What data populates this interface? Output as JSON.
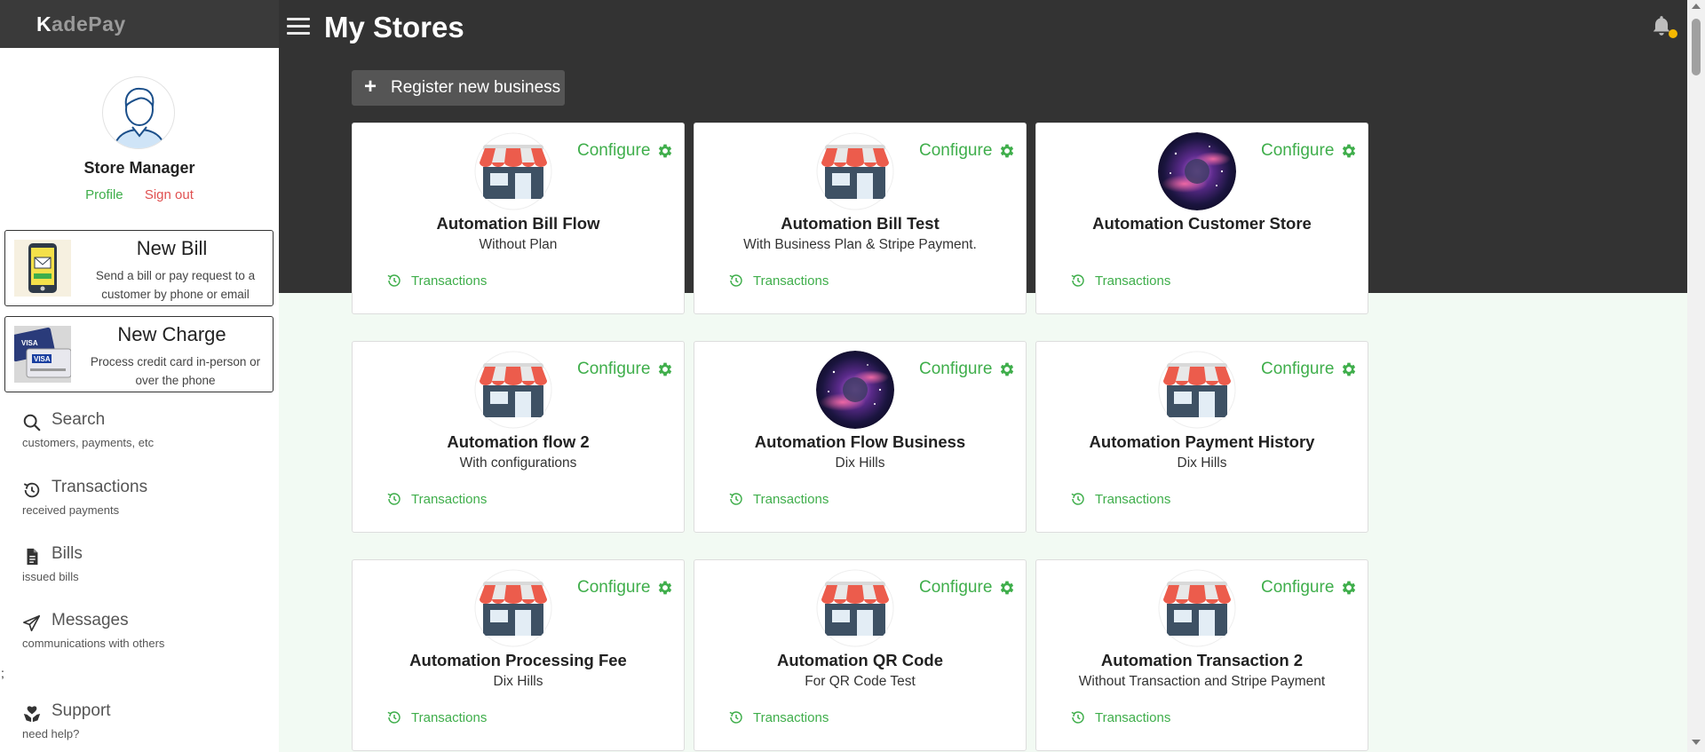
{
  "app": {
    "logo_first": "K",
    "logo_rest": "adePay"
  },
  "header": {
    "title": "My Stores"
  },
  "user": {
    "name": "Store Manager",
    "profile_label": "Profile",
    "signout_label": "Sign out"
  },
  "actions": [
    {
      "title": "New Bill",
      "desc": "Send a bill or pay request to a customer by phone or email"
    },
    {
      "title": "New Charge",
      "desc": "Process credit card in-person or over the phone"
    }
  ],
  "nav": [
    {
      "label": "Search",
      "sub": "customers, payments, etc",
      "icon": "search-icon"
    },
    {
      "label": "Transactions",
      "sub": "received payments",
      "icon": "history-icon"
    },
    {
      "label": "Bills",
      "sub": "issued bills",
      "icon": "document-icon"
    },
    {
      "label": "Messages",
      "sub": "communications with others",
      "icon": "send-icon"
    },
    {
      "label": "Support",
      "sub": "need help?",
      "icon": "support-icon"
    }
  ],
  "stray_text": ";",
  "register": {
    "label": "Register new business"
  },
  "stores": [
    {
      "name": "Automation Bill Flow",
      "sub": "Without Plan",
      "image": "storefront-icon",
      "configure": "Configure",
      "transactions": "Transactions"
    },
    {
      "name": "Automation Bill Test",
      "sub": "With Business Plan & Stripe Payment.",
      "image": "storefront-icon",
      "configure": "Configure",
      "transactions": "Transactions"
    },
    {
      "name": "Automation Customer Store",
      "sub": "",
      "image": "galaxy-image",
      "configure": "Configure",
      "transactions": "Transactions"
    },
    {
      "name": "Automation flow 2",
      "sub": "With configurations",
      "image": "storefront-icon",
      "configure": "Configure",
      "transactions": "Transactions"
    },
    {
      "name": "Automation Flow Business",
      "sub": "Dix Hills",
      "image": "galaxy-image",
      "configure": "Configure",
      "transactions": "Transactions"
    },
    {
      "name": "Automation Payment History",
      "sub": "Dix Hills",
      "image": "storefront-icon",
      "configure": "Configure",
      "transactions": "Transactions"
    },
    {
      "name": "Automation Processing Fee",
      "sub": "Dix Hills",
      "image": "storefront-icon",
      "configure": "Configure",
      "transactions": "Transactions"
    },
    {
      "name": "Automation QR Code",
      "sub": "For QR Code Test",
      "image": "storefront-icon",
      "configure": "Configure",
      "transactions": "Transactions"
    },
    {
      "name": "Automation Transaction 2",
      "sub": "Without Transaction and Stripe Payment",
      "image": "storefront-icon",
      "configure": "Configure",
      "transactions": "Transactions"
    }
  ],
  "colors": {
    "accent_green": "#3fae4b",
    "signout_red": "#e05050",
    "topbar": "#333333",
    "background": "#f2faf3",
    "notification_dot": "#f5b800"
  }
}
